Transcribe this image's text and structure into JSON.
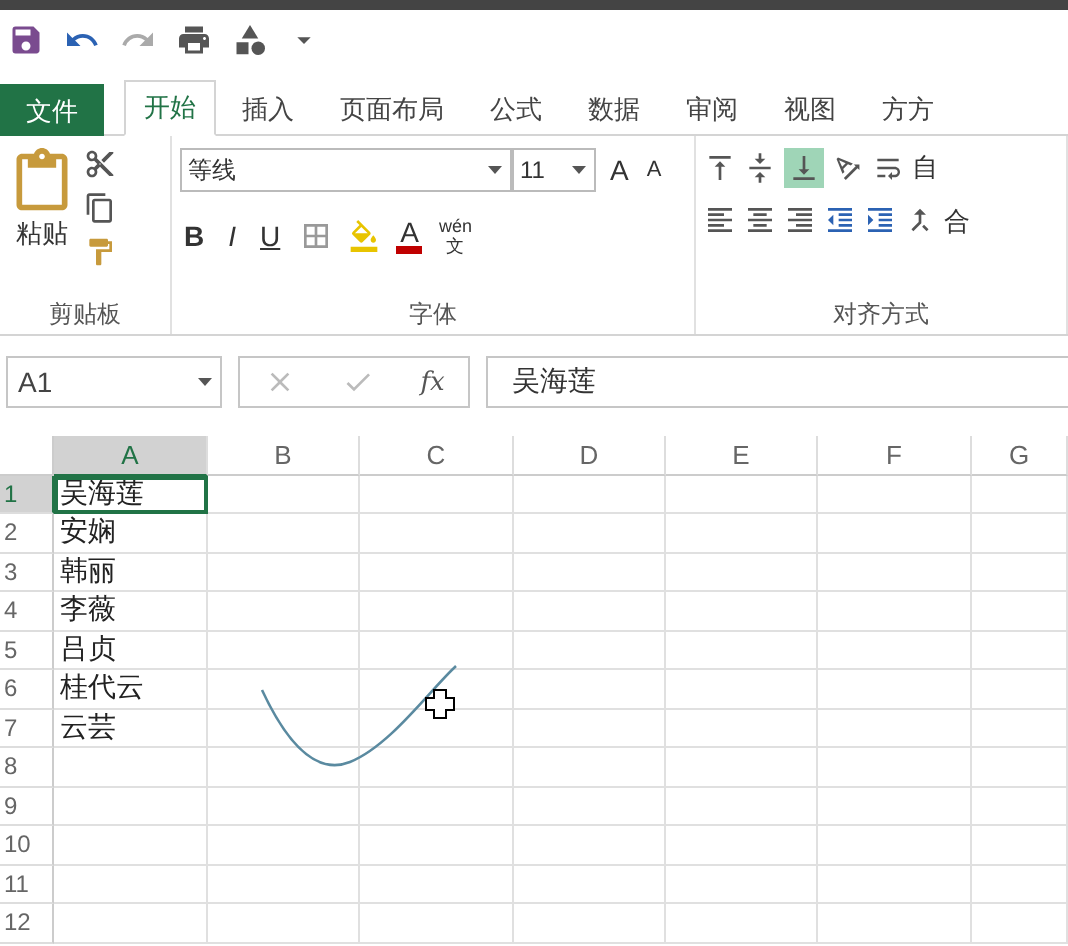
{
  "tabs": [
    {
      "label": "文件",
      "kind": "file",
      "selected": false
    },
    {
      "label": "开始",
      "kind": "tab",
      "selected": true
    },
    {
      "label": "插入",
      "kind": "tab",
      "selected": false
    },
    {
      "label": "页面布局",
      "kind": "tab",
      "selected": false
    },
    {
      "label": "公式",
      "kind": "tab",
      "selected": false
    },
    {
      "label": "数据",
      "kind": "tab",
      "selected": false
    },
    {
      "label": "审阅",
      "kind": "tab",
      "selected": false
    },
    {
      "label": "视图",
      "kind": "tab",
      "selected": false
    },
    {
      "label": "方方",
      "kind": "tab",
      "selected": false
    }
  ],
  "clipboard": {
    "paste": "粘贴",
    "label": "剪贴板"
  },
  "font": {
    "name": "等线",
    "size": "11",
    "grow": "A",
    "shrink": "A",
    "bold": "B",
    "italic": "I",
    "underline": "U",
    "font_color_glyph": "A",
    "phonetic_top": "wén",
    "phonetic_bottom": "文",
    "label": "字体"
  },
  "alignment": {
    "label": "对齐方式",
    "bottom_align_on": true,
    "wrap": "自",
    "merge": "合"
  },
  "formula_bar": {
    "name_box": "A1",
    "fx": "fx",
    "value": "吴海莲"
  },
  "columns": [
    {
      "label": "A",
      "selected": true
    },
    {
      "label": "B",
      "selected": false
    },
    {
      "label": "C",
      "selected": false
    },
    {
      "label": "D",
      "selected": false
    },
    {
      "label": "E",
      "selected": false
    },
    {
      "label": "F",
      "selected": false
    },
    {
      "label": "G",
      "selected": false
    }
  ],
  "rows": [
    {
      "number": "1",
      "selected": true,
      "value": "吴海莲",
      "active": true
    },
    {
      "number": "2",
      "selected": false,
      "value": "安娴",
      "active": false
    },
    {
      "number": "3",
      "selected": false,
      "value": "韩丽",
      "active": false
    },
    {
      "number": "4",
      "selected": false,
      "value": "李薇",
      "active": false
    },
    {
      "number": "5",
      "selected": false,
      "value": "吕贞",
      "active": false
    },
    {
      "number": "6",
      "selected": false,
      "value": "桂代云",
      "active": false
    },
    {
      "number": "7",
      "selected": false,
      "value": "云芸",
      "active": false
    },
    {
      "number": "8",
      "selected": false,
      "value": "",
      "active": false
    },
    {
      "number": "9",
      "selected": false,
      "value": "",
      "active": false
    },
    {
      "number": "10",
      "selected": false,
      "value": "",
      "active": false
    },
    {
      "number": "11",
      "selected": false,
      "value": "",
      "active": false
    },
    {
      "number": "12",
      "selected": false,
      "value": "",
      "active": false
    }
  ]
}
